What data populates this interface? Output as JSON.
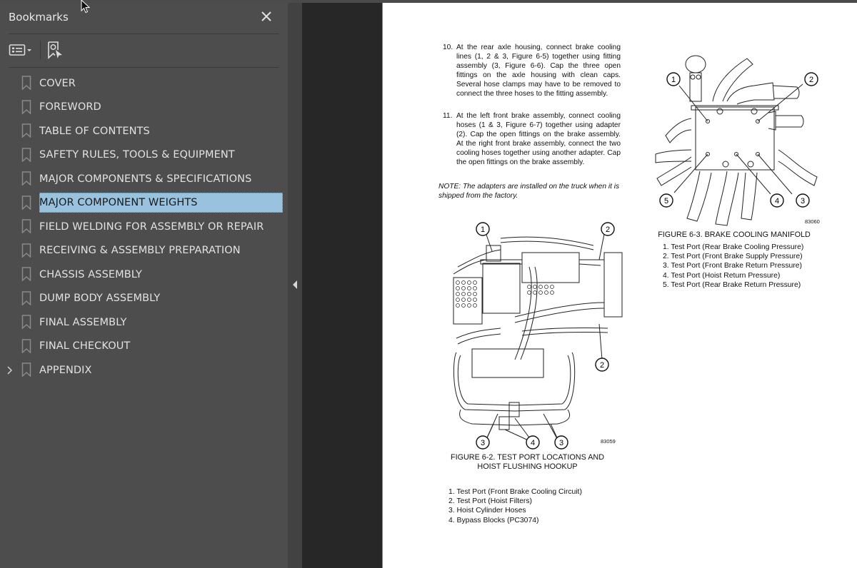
{
  "sidebar": {
    "title": "Bookmarks",
    "close_icon": "close-icon",
    "toolbar": {
      "options_icon": "list-options-icon",
      "options_dropdown_icon": "chevron-down-icon",
      "find_bookmark_icon": "find-current-bookmark-icon"
    },
    "items": [
      {
        "label": "COVER",
        "expandable": false,
        "selected": false
      },
      {
        "label": "FOREWORD",
        "expandable": false,
        "selected": false
      },
      {
        "label": "TABLE OF CONTENTS",
        "expandable": false,
        "selected": false
      },
      {
        "label": "SAFETY RULES, TOOLS & EQUIPMENT",
        "expandable": false,
        "selected": false
      },
      {
        "label": "MAJOR COMPONENTS & SPECIFICATIONS",
        "expandable": false,
        "selected": false
      },
      {
        "label": "MAJOR COMPONENT WEIGHTS",
        "expandable": false,
        "selected": true
      },
      {
        "label": "FIELD WELDING FOR ASSEMBLY OR REPAIR",
        "expandable": false,
        "selected": false
      },
      {
        "label": "RECEIVING & ASSEMBLY PREPARATION",
        "expandable": false,
        "selected": false
      },
      {
        "label": "CHASSIS ASSEMBLY",
        "expandable": false,
        "selected": false
      },
      {
        "label": "DUMP BODY ASSEMBLY",
        "expandable": false,
        "selected": false
      },
      {
        "label": "FINAL ASSEMBLY",
        "expandable": false,
        "selected": false
      },
      {
        "label": "FINAL CHECKOUT",
        "expandable": false,
        "selected": false
      },
      {
        "label": "APPENDIX",
        "expandable": true,
        "selected": false
      }
    ],
    "expander_glyph": "›",
    "collapse_panel_icon": "triangle-left-icon"
  },
  "colors": {
    "panel_bg": "#4d4d4d",
    "canvas_bg": "#272727",
    "selection_bg": "#98c2de",
    "page_bg": "#ffffff"
  },
  "document": {
    "steps": [
      {
        "num": "10.",
        "text": "At the rear axle housing, connect brake cooling lines (1, 2 & 3, Figure 6-5) together using fitting assembly (3, Figure 6-6). Cap the three open fittings on the axle housing with clean caps. Several hose clamps may have to be removed to connect the three hoses to the fitting assembly."
      },
      {
        "num": "11.",
        "text": "At the left front brake assembly, connect cooling hoses (1 & 3, Figure 6-7) together using adapter (2). Cap the open fittings on the brake assembly. At the right front brake assembly, connect the two cooling hoses together using another adapter. Cap the open fittings on the brake assembly."
      }
    ],
    "note": "NOTE: The adapters are installed on the truck when it is shipped from the factory.",
    "figure_6_3": {
      "drawing_number": "83060",
      "caption": "FIGURE 6-3. BRAKE COOLING MANIFOLD",
      "callouts": [
        "1",
        "2",
        "3",
        "4",
        "5"
      ],
      "legend": [
        "1. Test Port (Rear Brake Cooling Pressure)",
        "2. Test Port (Front Brake Supply Pressure)",
        "3. Test Port (Front Brake Return Pressure)",
        "4. Test Port (Hoist Return Pressure)",
        "5. Test Port (Rear Brake Return Pressure)"
      ]
    },
    "figure_6_2": {
      "drawing_number": "83059",
      "caption_line1": "FIGURE 6-2. TEST PORT LOCATIONS AND",
      "caption_line2": "HOIST FLUSHING HOOKUP",
      "callouts": [
        "1",
        "2",
        "2",
        "3",
        "4",
        "3"
      ],
      "legend": [
        "1. Test Port (Front Brake Cooling Circuit)",
        "2. Test Port (Hoist Filters)",
        "3. Hoist Cylinder Hoses",
        "4. Bypass Blocks (PC3074)"
      ]
    }
  }
}
